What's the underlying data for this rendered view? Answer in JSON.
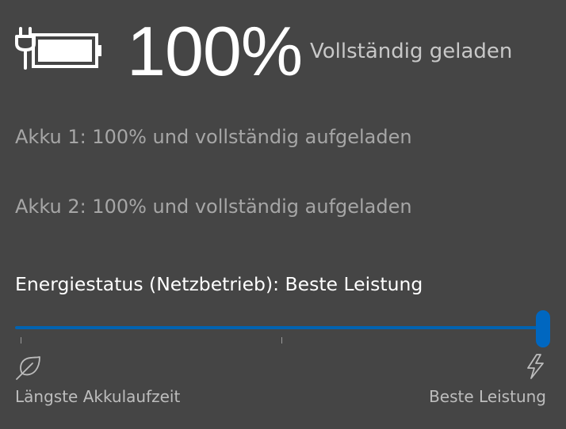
{
  "summary": {
    "icon": "battery-charging-plug-icon",
    "percent": "100%",
    "status": "Vollständig geladen"
  },
  "batteries": [
    {
      "label": "Akku 1: 100% und vollständig aufgeladen"
    },
    {
      "label": "Akku 2: 100% und vollständig aufgeladen"
    }
  ],
  "power_mode": {
    "title": "Energiestatus (Netzbetrieb): Beste Leistung",
    "slider_value": 1.0,
    "min_label": "Längste Akkulaufzeit",
    "max_label": "Beste Leistung",
    "min_icon": "leaf-icon",
    "max_icon": "lightning-bolt-icon"
  },
  "colors": {
    "background": "#454545",
    "accent": "#0067c0"
  }
}
